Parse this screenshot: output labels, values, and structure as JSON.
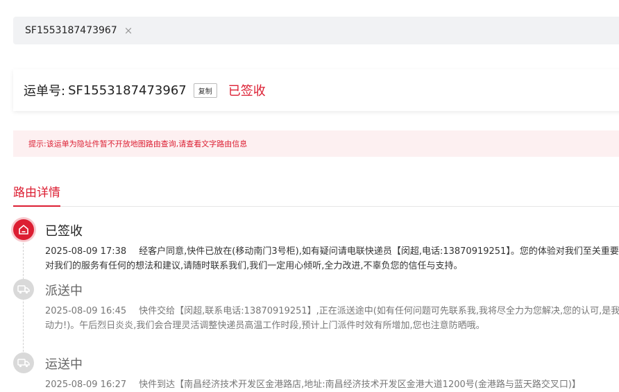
{
  "search": {
    "tag_value": "SF1553187473967",
    "close_glyph": "×"
  },
  "waybill": {
    "label": "运单号:",
    "number": "SF1553187473967",
    "copy_label": "复制",
    "status": "已签收"
  },
  "notice": {
    "text": "提示:该运单为隐址件暂不开放地图路由查询,请查看文字路由信息"
  },
  "section": {
    "tab_label": "路由详情"
  },
  "timeline": [
    {
      "status": "已签收",
      "icon": "house-icon",
      "state": "active",
      "time": "2025-08-09 17:38",
      "detail": "经客户同意,快件已放在(移动南门3号柜),如有疑问请电联快递员【闵超,电话:13870919251】。您的体验对我们至关重要,如果您对我们的服务有任何的想法和建议,请随时联系我们,我们一定用心倾听,全力改进,不辜负您的信任与支持。"
    },
    {
      "status": "派送中",
      "icon": "delivery-truck-icon",
      "state": "inactive",
      "time": "2025-08-09 16:45",
      "detail": "快件交给【闵超,联系电话:13870919251】,正在派送途中(如有任何问题可先联系我,我将尽全力为您解决,您的认可,是我最大的动力!)。午后烈日炎炎,我们会合理灵活调整快递员高温工作时段,预计上门派件时效有所增加,您也注意防晒哦。"
    },
    {
      "status": "运送中",
      "icon": "delivery-truck-icon",
      "state": "inactive",
      "time": "2025-08-09 16:27",
      "detail": "快件到达【南昌经济技术开发区金港路店,地址:南昌经济技术开发区金港大道1200号(金港路与蓝天路交叉口)】"
    }
  ],
  "colors": {
    "accent": "#dc1e32",
    "notice_bg": "#fdf0f1",
    "search_bg": "#f1f2f4",
    "inactive_icon": "#d9d9d9"
  }
}
